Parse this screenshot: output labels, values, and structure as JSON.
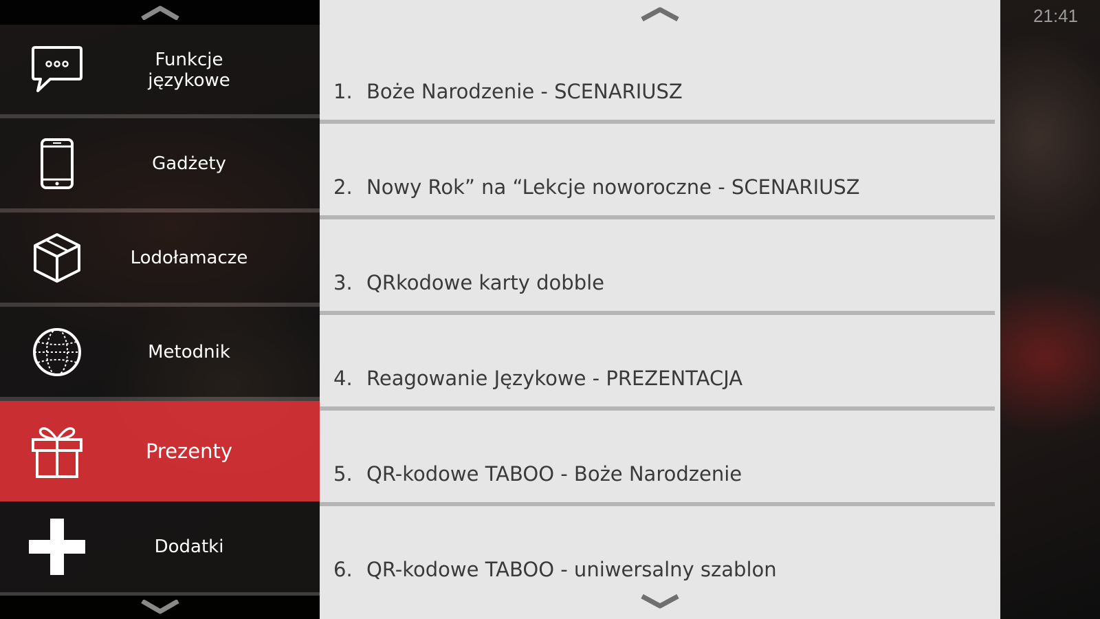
{
  "status_bar": {
    "time": "21:41"
  },
  "menu": {
    "items": [
      {
        "label": "Funkcje językowe",
        "icon": "chat-bubble-icon",
        "active": false
      },
      {
        "label": "Gadżety",
        "icon": "smartphone-icon",
        "active": false
      },
      {
        "label": "Lodołamacze",
        "icon": "cube-icon",
        "active": false
      },
      {
        "label": "Metodnik",
        "icon": "globe-icon",
        "active": false
      },
      {
        "label": "Prezenty",
        "icon": "gift-icon",
        "active": true
      },
      {
        "label": "Dodatki",
        "icon": "plus-icon",
        "active": false
      }
    ]
  },
  "list": {
    "items": [
      {
        "number": "1.",
        "title": "Boże Narodzenie - SCENARIUSZ"
      },
      {
        "number": "2.",
        "title": "Nowy Rok” na “Lekcje noworoczne - SCENARIUSZ"
      },
      {
        "number": "3.",
        "title": "QRkodowe karty dobble"
      },
      {
        "number": "4.",
        "title": "Reagowanie Językowe - PREZENTACJA"
      },
      {
        "number": "5.",
        "title": "QR-kodowe TABOO - Boże Narodzenie"
      },
      {
        "number": "6.",
        "title": "QR-kodowe TABOO - uniwersalny szablon"
      }
    ]
  },
  "colors": {
    "accent_active": "#d63036",
    "list_background": "#e6e6e6",
    "list_text": "#3a3a3a"
  }
}
